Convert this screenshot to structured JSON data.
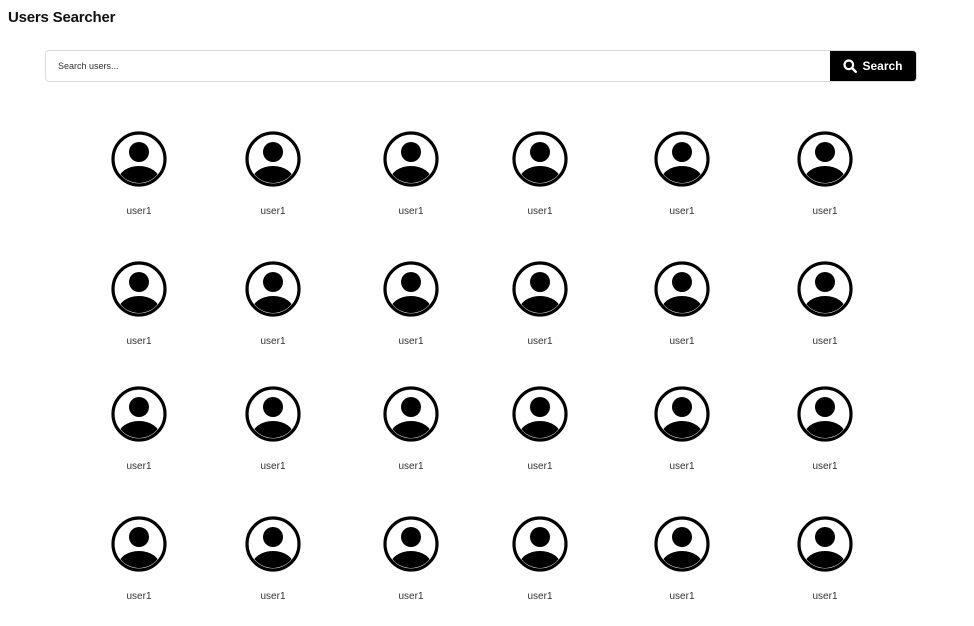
{
  "app": {
    "title": "Users Searcher"
  },
  "search": {
    "placeholder": "Search users...",
    "button_label": "Search"
  },
  "users": [
    {
      "name": "user1",
      "icon": "user-avatar-icon"
    },
    {
      "name": "user1",
      "icon": "user-avatar-icon"
    },
    {
      "name": "user1",
      "icon": "user-avatar-icon"
    },
    {
      "name": "user1",
      "icon": "user-avatar-icon"
    },
    {
      "name": "user1",
      "icon": "user-avatar-icon"
    },
    {
      "name": "user1",
      "icon": "user-avatar-icon"
    },
    {
      "name": "user1",
      "icon": "user-avatar-icon"
    },
    {
      "name": "user1",
      "icon": "user-avatar-icon"
    },
    {
      "name": "user1",
      "icon": "user-avatar-icon"
    },
    {
      "name": "user1",
      "icon": "user-avatar-icon"
    },
    {
      "name": "user1",
      "icon": "user-avatar-icon"
    },
    {
      "name": "user1",
      "icon": "user-avatar-icon"
    },
    {
      "name": "user1",
      "icon": "user-avatar-icon"
    },
    {
      "name": "user1",
      "icon": "user-avatar-icon"
    },
    {
      "name": "user1",
      "icon": "user-avatar-icon"
    },
    {
      "name": "user1",
      "icon": "user-avatar-icon"
    },
    {
      "name": "user1",
      "icon": "user-avatar-icon"
    },
    {
      "name": "user1",
      "icon": "user-avatar-icon"
    },
    {
      "name": "user1",
      "icon": "user-avatar-icon"
    },
    {
      "name": "user1",
      "icon": "user-avatar-icon"
    },
    {
      "name": "user1",
      "icon": "user-avatar-icon"
    },
    {
      "name": "user1",
      "icon": "user-avatar-icon"
    },
    {
      "name": "user1",
      "icon": "user-avatar-icon"
    },
    {
      "name": "user1",
      "icon": "user-avatar-icon"
    }
  ]
}
